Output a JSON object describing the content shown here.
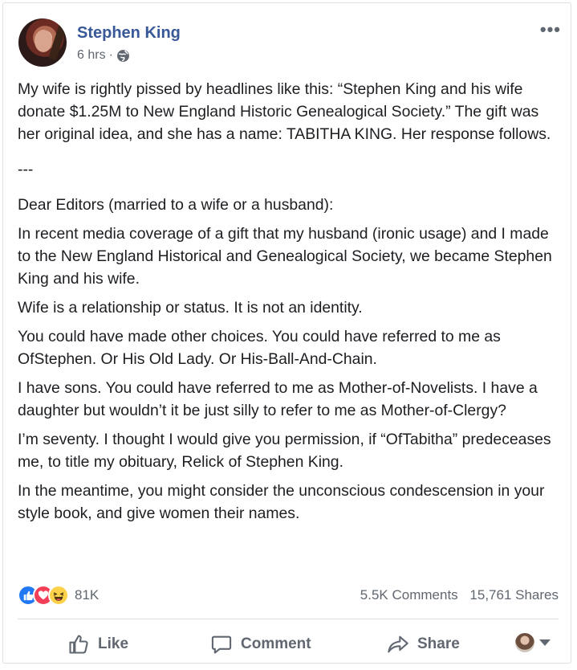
{
  "post": {
    "author": "Stephen King",
    "time": "6 hrs",
    "separator": "·",
    "paragraphs": [
      "My wife is rightly pissed by headlines like this: “Stephen King and his wife donate $1.25M to New England Historic Genealogical Society.” The gift was her original idea, and she has a name: TABITHA KING. Her response follows.",
      "---",
      "Dear Editors (married to a wife or a husband):",
      "In recent media coverage of a gift that my husband (ironic usage) and I made to the New England Historical and Genealogical Society, we became Stephen King and his wife.",
      "Wife is a relationship or status. It is not an identity.",
      "You could have made other choices. You could have referred to me as OfStephen. Or His Old Lady. Or His-Ball-And-Chain.",
      "I have sons. You could have referred to me as Mother-of-Novelists. I have a daughter but wouldn’t it be just silly to refer to me as Mother-of-Clergy?",
      "I’m seventy. I thought I would give you permission, if “OfTabitha” predeceases me, to title my obituary, Relick of Stephen King.",
      "In the meantime, you might consider the unconscious condescension in your style book, and give women their names."
    ]
  },
  "stats": {
    "reaction_count": "81K",
    "comments": "5.5K Comments",
    "shares": "15,761 Shares"
  },
  "actions": {
    "like": "Like",
    "comment": "Comment",
    "share": "Share"
  },
  "icons": {
    "more": "more-options-icon",
    "privacy": "globe-icon",
    "like": "thumbs-up-icon",
    "comment": "speech-bubble-icon",
    "share": "share-arrow-icon"
  },
  "colors": {
    "author_link": "#385898",
    "like_reaction": "#2078f4",
    "love_reaction": "#f33e58",
    "haha_reaction": "#fcd24a"
  }
}
